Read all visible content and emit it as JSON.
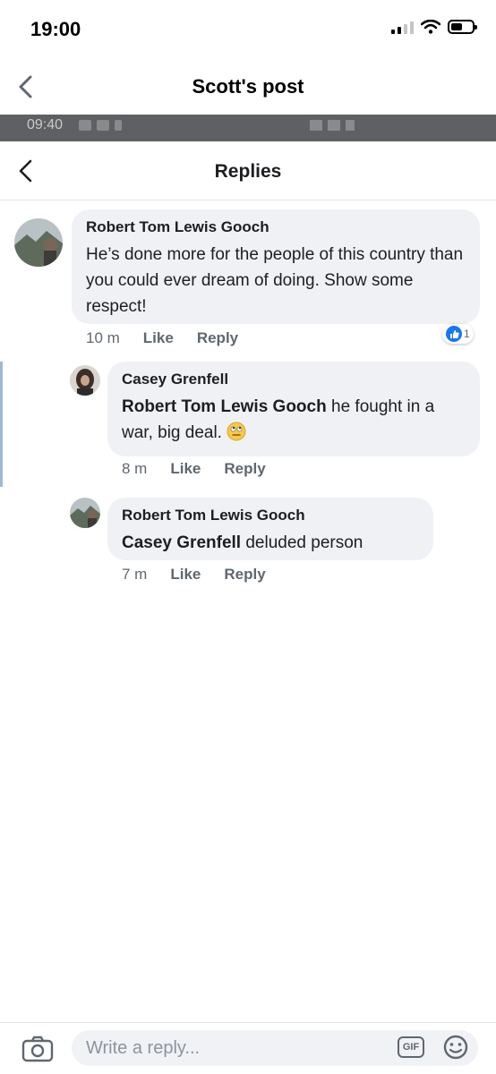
{
  "status_bar": {
    "time": "19:00"
  },
  "header": {
    "title": "Scott's post"
  },
  "inner_status": {
    "time": "09:40"
  },
  "replies_header": {
    "title": "Replies"
  },
  "comments": [
    {
      "author": "Robert Tom Lewis Gooch",
      "mention": "",
      "text": "He’s done more for the people of this country than you could ever dream of doing. Show some respect!",
      "time": "10 m",
      "like_label": "Like",
      "reply_label": "Reply",
      "reaction_count": "1"
    },
    {
      "author": "Casey Grenfell",
      "mention": "Robert Tom Lewis Gooch",
      "text": " he fought in a war, big deal.",
      "time": "8 m",
      "like_label": "Like",
      "reply_label": "Reply"
    },
    {
      "author": "Robert Tom Lewis Gooch",
      "mention": "Casey Grenfell",
      "text": " deluded person",
      "time": "7 m",
      "like_label": "Like",
      "reply_label": "Reply"
    }
  ],
  "composer": {
    "placeholder": "Write a reply...",
    "gif_label": "GIF"
  },
  "colors": {
    "bubble": "#eff1f4",
    "accent": "#1877f2",
    "muted": "#606770"
  }
}
